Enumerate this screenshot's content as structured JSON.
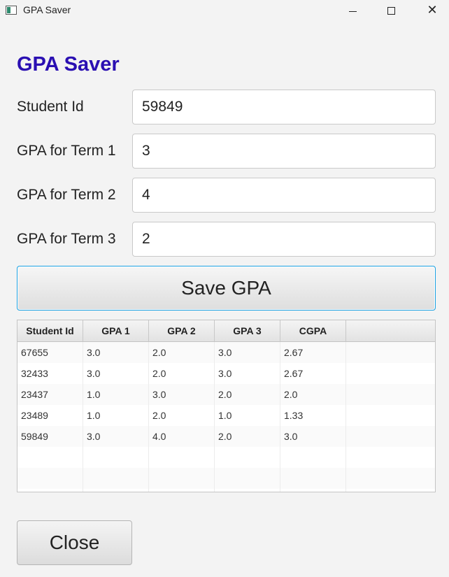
{
  "window": {
    "title": "GPA Saver",
    "controls": {
      "minimize": "minimize",
      "maximize": "maximize",
      "close": "✕"
    }
  },
  "heading": "GPA Saver",
  "form": {
    "student_id": {
      "label": "Student Id",
      "value": "59849"
    },
    "term1": {
      "label": "GPA for Term 1",
      "value": "3"
    },
    "term2": {
      "label": "GPA for Term 2",
      "value": "4"
    },
    "term3": {
      "label": "GPA for Term 3",
      "value": "2"
    }
  },
  "save_button": "Save GPA",
  "table": {
    "columns": [
      "Student Id",
      "GPA 1",
      "GPA 2",
      "GPA 3",
      "CGPA"
    ],
    "rows": [
      [
        "67655",
        "3.0",
        "2.0",
        "3.0",
        "2.67"
      ],
      [
        "32433",
        "3.0",
        "2.0",
        "3.0",
        "2.67"
      ],
      [
        "23437",
        "1.0",
        "3.0",
        "2.0",
        "2.0"
      ],
      [
        "23489",
        "1.0",
        "2.0",
        "1.0",
        "1.33"
      ],
      [
        "59849",
        "3.0",
        "4.0",
        "2.0",
        "3.0"
      ]
    ],
    "empty_rows": 3
  },
  "close_button": "Close",
  "colors": {
    "heading": "#2a0fb2",
    "focus_border": "#1ba1e2"
  }
}
